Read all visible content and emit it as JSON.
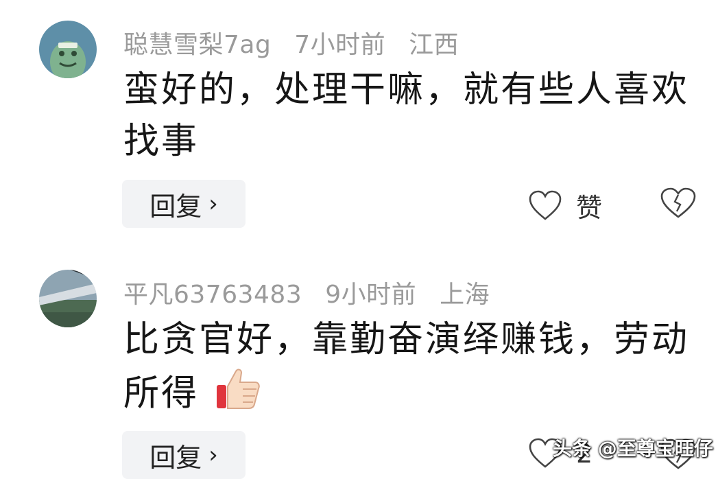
{
  "comments": [
    {
      "username": "聪慧雪梨7ag",
      "time": "7小时前",
      "location": "江西",
      "text": "蛮好的，处理干嘛，就有些人喜欢找事",
      "reply_label": "回复",
      "like_label": "赞",
      "avatar_icon": "green-cartoon-avatar"
    },
    {
      "username": "平凡63763483",
      "time": "9小时前",
      "location": "上海",
      "text": "比贪官好，靠勤奋演绎赚钱，劳动所得",
      "reply_label": "回复",
      "like_count": "2",
      "avatar_icon": "airplane-window-photo-avatar",
      "emoji": "thumbs-up-icon"
    }
  ],
  "watermark": "头条 @至尊宝旺仔",
  "colors": {
    "meta": "#9a9a9a",
    "text": "#161616",
    "reply_bg": "#f2f3f5"
  }
}
